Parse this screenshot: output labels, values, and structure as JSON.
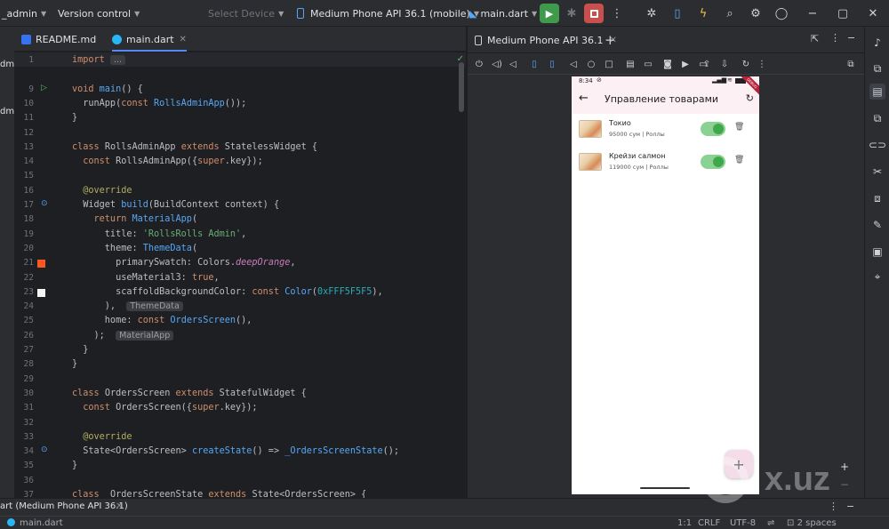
{
  "toolbar": {
    "project": "_admin",
    "version_control": "Version control",
    "select_device": "Select Device",
    "device": "Medium Phone API 36.1 (mobile)",
    "run_config": "main.dart"
  },
  "left_strip": {
    "labels": [
      "dm",
      "dm"
    ]
  },
  "editor_tabs": [
    {
      "label": "README.md"
    },
    {
      "label": "main.dart"
    }
  ],
  "code_lines": [
    {
      "n": "1",
      "segs": [
        [
          "kw",
          "import "
        ],
        [
          "inlay",
          "..."
        ]
      ]
    },
    {
      "n": "",
      "segs": []
    },
    {
      "n": "9",
      "segs": [
        [
          "kw",
          "void "
        ],
        [
          "fn",
          "main"
        ],
        [
          "",
          "() {"
        ]
      ]
    },
    {
      "n": "10",
      "segs": [
        [
          "",
          "  runApp("
        ],
        [
          "kw",
          "const "
        ],
        [
          "fn",
          "RollsAdminApp"
        ],
        [
          "",
          "());"
        ]
      ]
    },
    {
      "n": "11",
      "segs": [
        [
          "",
          "}"
        ]
      ]
    },
    {
      "n": "12",
      "segs": []
    },
    {
      "n": "13",
      "segs": [
        [
          "kw",
          "class "
        ],
        [
          "",
          "RollsAdminApp "
        ],
        [
          "kw",
          "extends "
        ],
        [
          "",
          "StatelessWidget {"
        ]
      ]
    },
    {
      "n": "14",
      "segs": [
        [
          "kw",
          "  const "
        ],
        [
          "",
          "RollsAdminApp({"
        ],
        [
          "kw",
          "super"
        ],
        [
          "",
          ".key});"
        ]
      ]
    },
    {
      "n": "15",
      "segs": []
    },
    {
      "n": "16",
      "segs": [
        [
          "ann",
          "  @override"
        ]
      ]
    },
    {
      "n": "17",
      "segs": [
        [
          "",
          "  Widget "
        ],
        [
          "fn",
          "build"
        ],
        [
          "",
          "(BuildContext context) {"
        ]
      ]
    },
    {
      "n": "18",
      "segs": [
        [
          "kw",
          "    return "
        ],
        [
          "fn",
          "MaterialApp"
        ],
        [
          "",
          "("
        ]
      ]
    },
    {
      "n": "19",
      "segs": [
        [
          "",
          "      title: "
        ],
        [
          "str",
          "'RollsRolls Admin'"
        ],
        [
          "",
          ","
        ]
      ]
    },
    {
      "n": "20",
      "segs": [
        [
          "",
          "      theme: "
        ],
        [
          "fn",
          "ThemeData"
        ],
        [
          "",
          "("
        ]
      ]
    },
    {
      "n": "21",
      "segs": [
        [
          "",
          "        primarySwatch: Colors."
        ],
        [
          "ital",
          "deepOrange"
        ],
        [
          "",
          ","
        ]
      ]
    },
    {
      "n": "22",
      "segs": [
        [
          "",
          "        useMaterial3: "
        ],
        [
          "kw",
          "true"
        ],
        [
          "",
          ","
        ]
      ]
    },
    {
      "n": "23",
      "segs": [
        [
          "",
          "        scaffoldBackgroundColor: "
        ],
        [
          "kw",
          "const "
        ],
        [
          "fn",
          "Color"
        ],
        [
          "",
          "("
        ],
        [
          "num",
          "0xFFF5F5F5"
        ],
        [
          "",
          "),"
        ]
      ]
    },
    {
      "n": "24",
      "segs": [
        [
          "",
          "      ),  "
        ],
        [
          "inlay",
          "ThemeData"
        ]
      ]
    },
    {
      "n": "25",
      "segs": [
        [
          "",
          "      home: "
        ],
        [
          "kw",
          "const "
        ],
        [
          "fn",
          "OrdersScreen"
        ],
        [
          "",
          "(),"
        ]
      ]
    },
    {
      "n": "26",
      "segs": [
        [
          "",
          "    );  "
        ],
        [
          "inlay",
          "MaterialApp"
        ]
      ]
    },
    {
      "n": "27",
      "segs": [
        [
          "",
          "  }"
        ]
      ]
    },
    {
      "n": "28",
      "segs": [
        [
          "",
          "}"
        ]
      ]
    },
    {
      "n": "29",
      "segs": []
    },
    {
      "n": "30",
      "segs": [
        [
          "kw",
          "class "
        ],
        [
          "",
          "OrdersScreen "
        ],
        [
          "kw",
          "extends "
        ],
        [
          "",
          "StatefulWidget {"
        ]
      ]
    },
    {
      "n": "31",
      "segs": [
        [
          "kw",
          "  const "
        ],
        [
          "",
          "OrdersScreen({"
        ],
        [
          "kw",
          "super"
        ],
        [
          "",
          ".key});"
        ]
      ]
    },
    {
      "n": "32",
      "segs": []
    },
    {
      "n": "33",
      "segs": [
        [
          "ann",
          "  @override"
        ]
      ]
    },
    {
      "n": "34",
      "segs": [
        [
          "",
          "  State<OrdersScreen> "
        ],
        [
          "fn",
          "createState"
        ],
        [
          "",
          "() => "
        ],
        [
          "fn",
          "_OrdersScreenState"
        ],
        [
          "",
          "();"
        ]
      ]
    },
    {
      "n": "35",
      "segs": [
        [
          "",
          "}"
        ]
      ]
    },
    {
      "n": "36",
      "segs": []
    },
    {
      "n": "37",
      "segs": [
        [
          "kw",
          "class "
        ],
        [
          "",
          "_OrdersScreenState "
        ],
        [
          "kw",
          "extends "
        ],
        [
          "",
          "State<OrdersScreen> {"
        ]
      ]
    }
  ],
  "device_panel": {
    "tab_label": "Medium Phone API 36.1"
  },
  "phone": {
    "time": "8:34",
    "title": "Управление товарами",
    "ribbon": "DEBUG",
    "products": [
      {
        "name": "Токио",
        "meta": "95000 сум | Роллы"
      },
      {
        "name": "Крейзи салмон",
        "meta": "119000 сум | Роллы"
      }
    ],
    "fab": "+"
  },
  "zoom": {
    "plus": "+",
    "minus": "−",
    "one_to_one": "1:1"
  },
  "run_bar": {
    "label": "art (Medium Phone API 36.1)"
  },
  "status_bar": {
    "file": "main.dart",
    "position": "1:1",
    "line_sep": "CRLF",
    "encoding": "UTF-8",
    "indent": "2 spaces"
  },
  "watermark": {
    "text": "x.uz"
  },
  "colors": {
    "run_green": "#3f9a4b",
    "stop_red": "#c94f4f",
    "accent_blue": "#548af7",
    "switch_green": "#3ea84a"
  }
}
